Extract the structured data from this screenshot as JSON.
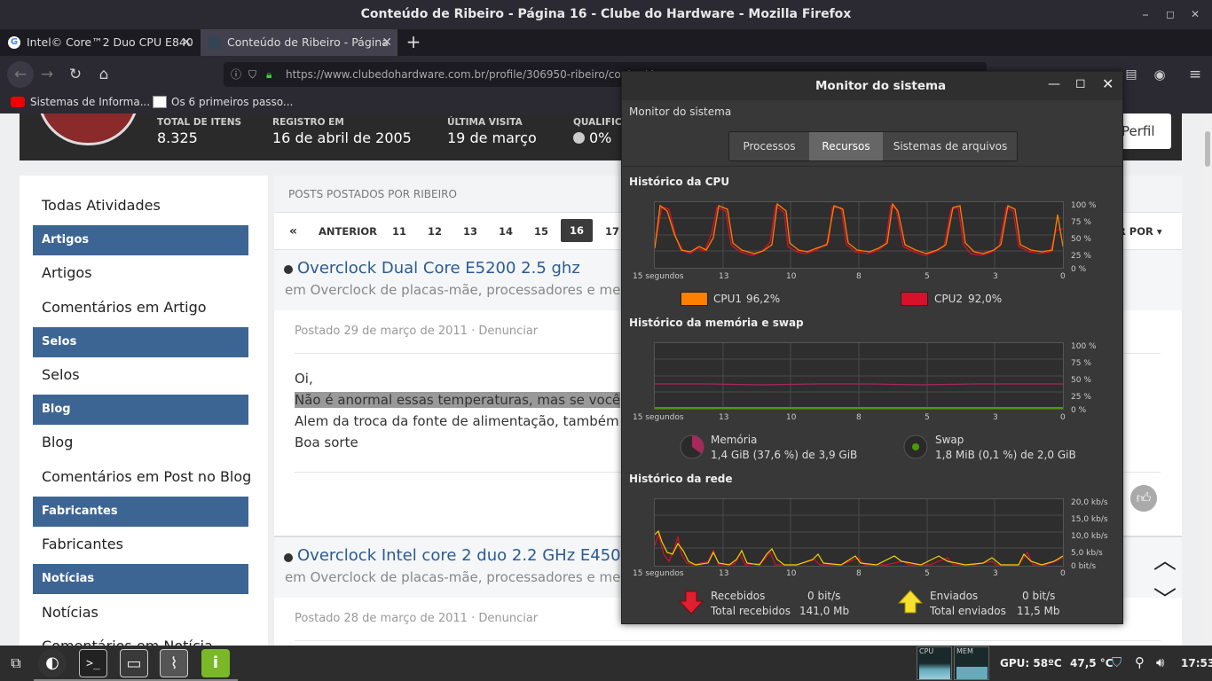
{
  "window": {
    "title": "Conteúdo de Ribeiro - Página 16 - Clube do Hardware - Mozilla Firefox"
  },
  "tabs": [
    {
      "label": "Intel© Core™2 Duo CPU E840",
      "close": "✕"
    },
    {
      "label": "Conteúdo de Ribeiro - Página",
      "close": "✕"
    }
  ],
  "new_tab": "+",
  "url": "https://www.clubedohardware.com.br/profile/306950-ribeiro/content/",
  "url_domain": "clubedohardware.com.br",
  "bookmarks": [
    {
      "label": "Sistemas de Informa..."
    },
    {
      "label": "Os 6 primeiros passo..."
    }
  ],
  "profile": {
    "stats": [
      {
        "label": "TOTAL DE ITENS",
        "value": "8.325"
      },
      {
        "label": "REGISTRO EM",
        "value": "16 de abril de 2005"
      },
      {
        "label": "ÚLTIMA VISITA",
        "value": "19 de março"
      },
      {
        "label": "QUALIFICA",
        "value": "0%"
      }
    ],
    "profile_button": "Perfil"
  },
  "sidebar": {
    "top": "Todas Atividades",
    "sections": [
      {
        "header": "Artigos",
        "items": [
          "Artigos",
          "Comentários em Artigo"
        ]
      },
      {
        "header": "Selos",
        "items": [
          "Selos"
        ]
      },
      {
        "header": "Blog",
        "items": [
          "Blog",
          "Comentários em Post no Blog"
        ]
      },
      {
        "header": "Fabricantes",
        "items": [
          "Fabricantes"
        ]
      },
      {
        "header": "Notícias",
        "items": [
          "Notícias",
          "Comentários em Notícia"
        ]
      }
    ]
  },
  "main": {
    "section_title": "POSTS POSTADOS POR RIBEIRO",
    "pagination": {
      "first": "«",
      "prev": "ANTERIOR",
      "pages": [
        "11",
        "12",
        "13",
        "14",
        "15",
        "16",
        "17"
      ],
      "current": "16",
      "sort": "AR POR"
    },
    "posts": [
      {
        "title": "Overclock Dual Core E5200 2.5 ghz",
        "sub": "em Overclock de placas-mãe, processadores e me",
        "meta": "Postado 29 de março de 2011 · Denunciar",
        "lines": [
          "Oi,",
          "Não é anormal essas temperaturas, mas se você",
          "Alem da troca da fonte de alimentação, também",
          "Boa sorte"
        ]
      },
      {
        "title": "Overclock Intel core 2 duo 2.2 GHz E4500",
        "sub": "em Overclock de placas-mãe, processadores e me",
        "meta": "Postado 28 de março de 2011 · Denunciar"
      }
    ]
  },
  "sysmon": {
    "window_title": "Monitor do sistema",
    "app_label": "Monitor do sistema",
    "tabs": [
      "Processos",
      "Recursos",
      "Sistemas de arquivos"
    ],
    "active_tab": "Recursos",
    "cpu": {
      "heading": "Histórico da CPU",
      "y_ticks": [
        "100 %",
        "75 %",
        "50 %",
        "25 %",
        "0 %"
      ],
      "x_ticks": [
        "15 segundos",
        "13",
        "10",
        "8",
        "5",
        "3",
        "0"
      ],
      "legend": [
        {
          "name": "CPU1",
          "value": "96,2%",
          "color": "#ff7f00"
        },
        {
          "name": "CPU2",
          "value": "92,0%",
          "color": "#d7102c"
        }
      ]
    },
    "memory": {
      "heading": "Histórico da memória e swap",
      "y_ticks": [
        "100 %",
        "75 %",
        "50 %",
        "25 %",
        "0 %"
      ],
      "x_ticks": [
        "15 segundos",
        "13",
        "10",
        "8",
        "5",
        "3",
        "0"
      ],
      "mem_label": "Memória",
      "mem_value": "1,4 GiB (37,6 %) de 3,9 GiB",
      "swap_label": "Swap",
      "swap_value": "1,8 MiB (0,1 %) de 2,0 GiB"
    },
    "network": {
      "heading": "Histórico da rede",
      "y_ticks": [
        "20,0 kb/s",
        "15,0 kb/s",
        "10,0 kb/s",
        "5,0 kb/s",
        "0 bit/s"
      ],
      "x_ticks": [
        "15 segundos",
        "13",
        "10",
        "8",
        "5",
        "3",
        "0"
      ],
      "recv_label": "Recebidos",
      "recv_value": "0 bit/s",
      "recv_total_label": "Total recebidos",
      "recv_total": "141,0 Mb",
      "sent_label": "Enviados",
      "sent_value": "0 bit/s",
      "sent_total_label": "Total enviados",
      "sent_total": "11,5 Mb"
    }
  },
  "taskbar": {
    "gpu": "GPU: 58ºC",
    "temp": "47,5 °C",
    "clock": "17:53",
    "cpu_label": "CPU",
    "mem_label": "MEM"
  }
}
